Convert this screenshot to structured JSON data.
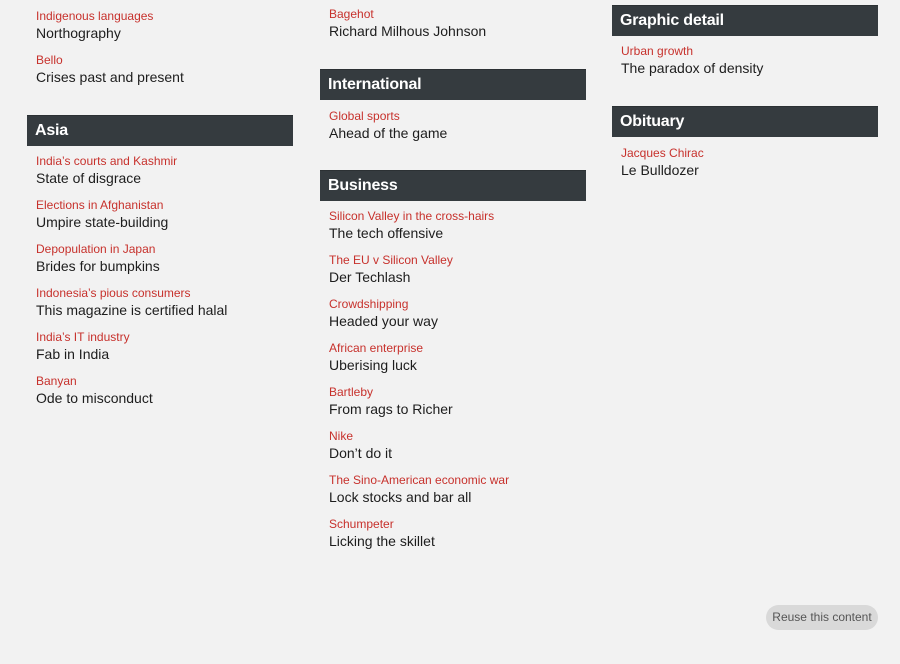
{
  "columns": [
    {
      "sections": [
        {
          "title": "",
          "articles": [
            {
              "flytitle": "Indigenous languages",
              "headline": "Northography"
            },
            {
              "flytitle": "Bello",
              "headline": "Crises past and present"
            }
          ]
        },
        {
          "title": "Asia",
          "articles": [
            {
              "flytitle": "India’s courts and Kashmir",
              "headline": "State of disgrace"
            },
            {
              "flytitle": "Elections in Afghanistan",
              "headline": "Umpire state-building"
            },
            {
              "flytitle": "Depopulation in Japan",
              "headline": "Brides for bumpkins"
            },
            {
              "flytitle": "Indonesia’s pious consumers",
              "headline": "This magazine is certified halal"
            },
            {
              "flytitle": "India’s IT industry",
              "headline": "Fab in India"
            },
            {
              "flytitle": "Banyan",
              "headline": "Ode to misconduct"
            }
          ]
        }
      ]
    },
    {
      "sections": [
        {
          "title": "",
          "articles": [
            {
              "flytitle": "Bagehot",
              "headline": "Richard Milhous Johnson"
            }
          ]
        },
        {
          "title": "International",
          "articles": [
            {
              "flytitle": "Global sports",
              "headline": "Ahead of the game"
            }
          ]
        },
        {
          "title": "Business",
          "articles": [
            {
              "flytitle": "Silicon Valley in the cross-hairs",
              "headline": "The tech offensive"
            },
            {
              "flytitle": "The EU v Silicon Valley",
              "headline": "Der Techlash"
            },
            {
              "flytitle": "Crowdshipping",
              "headline": "Headed your way"
            },
            {
              "flytitle": "African enterprise",
              "headline": "Uberising luck"
            },
            {
              "flytitle": "Bartleby",
              "headline": "From rags to Richer"
            },
            {
              "flytitle": "Nike",
              "headline": "Don’t do it"
            },
            {
              "flytitle": "The Sino-American economic war",
              "headline": "Lock stocks and bar all"
            },
            {
              "flytitle": "Schumpeter",
              "headline": "Licking the skillet"
            }
          ]
        }
      ]
    },
    {
      "sections": [
        {
          "title": "Graphic detail",
          "articles": [
            {
              "flytitle": "Urban growth",
              "headline": "The paradox of density"
            }
          ]
        },
        {
          "title": "Obituary",
          "articles": [
            {
              "flytitle": "Jacques Chirac",
              "headline": "Le Bulldozer"
            }
          ]
        }
      ]
    }
  ],
  "reuse_button": {
    "label": "Reuse this content"
  },
  "colors": {
    "flytitle": "#c7312c",
    "section_header_bg": "#353b3f",
    "page_bg": "#f2f2f2"
  }
}
